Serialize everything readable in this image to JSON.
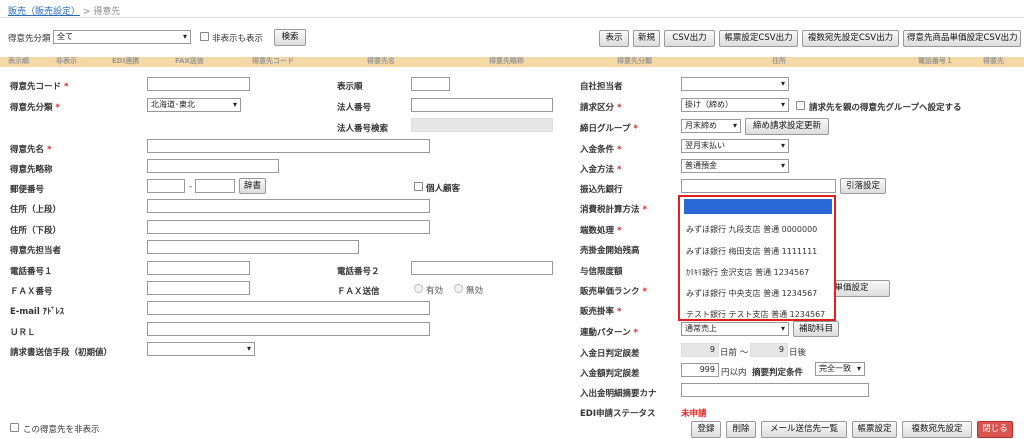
{
  "breadcrumb": {
    "link": "販売（販売設定）",
    "sep": ">",
    "current": "得意先"
  },
  "filter": {
    "label": "得意先分類",
    "select_value": "全て",
    "checkbox_label": "非表示も表示",
    "search_button": "検索"
  },
  "toolbar": {
    "display": "表示",
    "new": "新規",
    "csv": "CSV出力",
    "form_csv": "帳票設定CSV出力",
    "multi_csv": "複数宛先設定CSV出力",
    "price_csv": "得意先商品単価設定CSV出力"
  },
  "header_columns": [
    "表示順",
    "非表示",
    "EDI連携",
    "FAX送信",
    "得意先コード",
    "得意先名",
    "得意先略称",
    "得意先分類",
    "住所",
    "電話番号１",
    "得意先"
  ],
  "left": {
    "code_label": "得意先コード",
    "category_label": "得意先分類",
    "category_value": "北海道･東北",
    "name_label": "得意先名",
    "short_label": "得意先略称",
    "zip_label": "郵便番号",
    "zip_sep": "-",
    "dict_button": "辞書",
    "personal_label": "個人顧客",
    "addr1_label": "住所（上段）",
    "addr2_label": "住所（下段）",
    "person_label": "得意先担当者",
    "tel1_label": "電話番号１",
    "fax_label": "ＦＡＸ番号",
    "email_label": "E-mail ｱﾄﾞﾚｽ",
    "url_label": "ＵＲＬ",
    "send_method_label": "請求書送信手段（初期値）",
    "hide_label": "この得意先を非表示"
  },
  "mid": {
    "order_label": "表示順",
    "corp_no_label": "法人番号",
    "corp_check_label": "法人番号検索",
    "tel2_label": "電話番号２",
    "fax_send_label": "ＦＡＸ送信",
    "radio_yes": "有効",
    "radio_no": "無効"
  },
  "right": {
    "staff_label": "自社担当者",
    "billing_label": "請求区分",
    "billing_value": "掛け（締め）",
    "billing_check": "請求先を親の得意先グループへ設定する",
    "closing_label": "締日グループ",
    "closing_value": "月末締め",
    "closing_button": "締め請求設定更新",
    "payment_cond_label": "入金条件",
    "payment_cond_value": "翌月末払い",
    "payment_method_label": "入金方法",
    "payment_method_value": "普通預金",
    "bank_label": "振込先銀行",
    "bank_button": "引落設定",
    "tax_label": "消費税計算方法",
    "fraction_label": "端数処理",
    "ar_label": "売掛金開始残高",
    "credit_label": "与信限度額",
    "price_rank_label": "販売単価ランク",
    "price_button": "商品単価設定",
    "rate_label": "販売掛率",
    "link_label": "連動パターン",
    "link_value": "通常売上",
    "sub_button": "補助科目",
    "date_tol_label": "入金日判定誤差",
    "date_from": "9",
    "date_from_unit": "日前 〜",
    "date_to": "9",
    "date_to_unit": "日後",
    "amount_tol_label": "入金額判定誤差",
    "amount_value": "999",
    "amount_unit": "円以内",
    "summary_label": "摘要判定条件",
    "summary_value": "完全一致",
    "kana_label": "入出金明細摘要カナ",
    "edi_label": "EDI申請ステータス",
    "edi_value": "未申請"
  },
  "bank_options": [
    "みずほ銀行 九段支店 普通 0000000",
    "みずほ銀行 梅田支店 普通 1111111",
    "ｶﾘｷﾘ銀行 金沢支店 普通 1234567",
    "みずほ銀行 中央支店 普通 1234567",
    "テスト銀行 テスト支店 普通 1234567"
  ],
  "footer": {
    "register": "登録",
    "delete": "削除",
    "mail": "メール送信先一覧",
    "form": "帳票設定",
    "multi": "複数宛先設定",
    "close": "閉じる"
  }
}
